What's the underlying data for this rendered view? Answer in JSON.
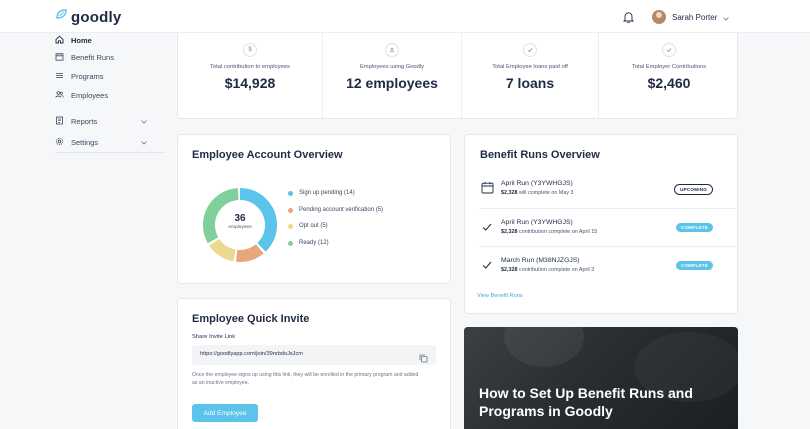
{
  "header": {
    "logo_text": "goodly",
    "user_name": "Sarah Porter"
  },
  "sidebar": {
    "items": [
      {
        "label": "Home",
        "icon": "home-icon"
      },
      {
        "label": "Benefit Runs",
        "icon": "calendar-icon"
      },
      {
        "label": "Programs",
        "icon": "list-icon"
      },
      {
        "label": "Employees",
        "icon": "users-icon"
      },
      {
        "label": "Reports",
        "icon": "report-icon"
      },
      {
        "label": "Settings",
        "icon": "gear-icon"
      }
    ]
  },
  "stats": [
    {
      "label": "Total contribution to employees",
      "value": "$14,928",
      "icon": "$"
    },
    {
      "label": "Employees using Goodly",
      "value": "12 employees",
      "icon": "person-icon"
    },
    {
      "label": "Total Employee loans paid off",
      "value": "7 loans",
      "icon": "check-icon"
    },
    {
      "label": "Total Employer Contributions",
      "value": "$2,460",
      "icon": "check-icon"
    }
  ],
  "overview": {
    "title": "Employee Account Overview",
    "center_value": "36",
    "center_label": "employees",
    "legend": [
      {
        "label": "Sign up pending (14)",
        "count": 14,
        "color": "#5cc3ea"
      },
      {
        "label": "Pending account verification (5)",
        "count": 5,
        "color": "#e8a77a"
      },
      {
        "label": "Opt out (5)",
        "count": 5,
        "color": "#ead98e"
      },
      {
        "label": "Ready (12)",
        "count": 12,
        "color": "#7fd09a"
      }
    ]
  },
  "runs": {
    "title": "Benefit Runs Overview",
    "items": [
      {
        "title": "April Run (Y3YWHGJS)",
        "amount": "$2,328",
        "sub": " will complete on May 3",
        "badge": "UPCOMING",
        "status": "upcoming",
        "icon": "calendar-icon"
      },
      {
        "title": "April Run (Y3YWHGJS)",
        "amount": "$2,328",
        "sub": " contribution complete on April 15",
        "badge": "COMPLETE",
        "status": "complete",
        "icon": "check-icon"
      },
      {
        "title": "March Run (M38NJZGJS)",
        "amount": "$2,328",
        "sub": " contribution complete on April 3",
        "badge": "COMPLETE",
        "status": "complete",
        "icon": "check-icon"
      }
    ],
    "view_link": "View Benefit Runs"
  },
  "invite": {
    "title": "Employee Quick Invite",
    "share_label": "Share Invite Link",
    "url": "https://goodlyapp.com/join/39nrbdoJsJcm",
    "note": "Once the employee signs up using this link, they will be enrolled in the primary program and added as an inactive employee.",
    "button": "Add Employee"
  },
  "promo": {
    "title": "How to Set Up Benefit Runs and Programs in Goodly"
  },
  "colors": {
    "accent": "#5cc3ea",
    "text": "#1f2a44"
  }
}
